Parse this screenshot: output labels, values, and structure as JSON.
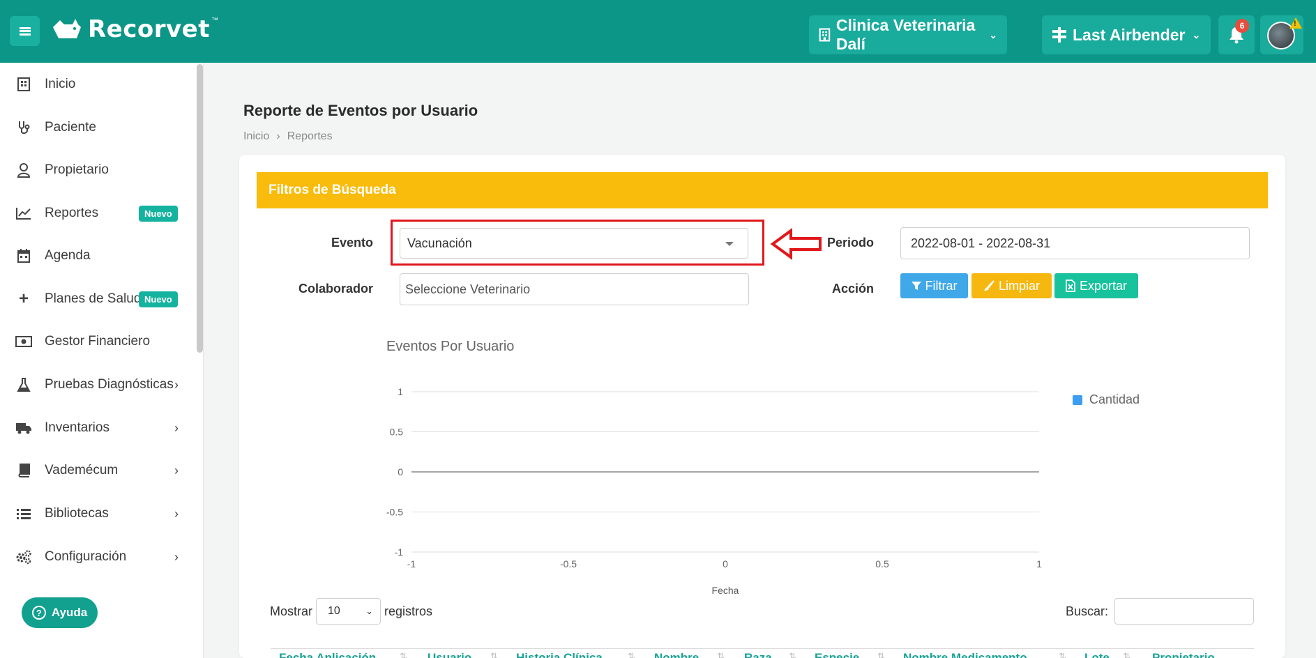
{
  "header": {
    "brand": "Recorvet",
    "brand_tm": "™",
    "clinic": "Clinica Veterinaria Dalí",
    "branch": "Last Airbender",
    "notifications_count": "6",
    "accent_color": "#0b9688"
  },
  "sidebar": {
    "items": [
      {
        "label": "Inicio",
        "icon": "hospital-icon"
      },
      {
        "label": "Paciente",
        "icon": "stethoscope-icon"
      },
      {
        "label": "Propietario",
        "icon": "user-icon"
      },
      {
        "label": "Reportes",
        "icon": "chart-line-icon",
        "badge": "Nuevo"
      },
      {
        "label": "Agenda",
        "icon": "calendar-icon"
      },
      {
        "label": "Planes de Salud",
        "icon": "plus-icon",
        "badge": "Nuevo"
      },
      {
        "label": "Gestor Financiero",
        "icon": "money-bill-icon"
      },
      {
        "label": "Pruebas Diagnósticas",
        "icon": "flask-icon"
      },
      {
        "label": "Inventarios",
        "icon": "truck-icon"
      },
      {
        "label": "Vademécum",
        "icon": "book-icon"
      },
      {
        "label": "Bibliotecas",
        "icon": "list-icon"
      },
      {
        "label": "Configuración",
        "icon": "gears-icon"
      }
    ],
    "help_label": "Ayuda"
  },
  "page": {
    "title": "Reporte de Eventos por Usuario",
    "breadcrumb": [
      "Inicio",
      "Reportes"
    ]
  },
  "filters": {
    "heading": "Filtros de Búsqueda",
    "evento_label": "Evento",
    "evento_value": "Vacunación",
    "periodo_label": "Periodo",
    "periodo_value": "2022-08-01 - 2022-08-31",
    "colaborador_label": "Colaborador",
    "colaborador_placeholder": "Seleccione Veterinario",
    "accion_label": "Acción",
    "btn_filtrar": "Filtrar",
    "btn_limpiar": "Limpiar",
    "btn_exportar": "Exportar",
    "colors": {
      "filtrar": "#3fa8e8",
      "limpiar": "#f6b70e",
      "exportar": "#18c29c",
      "header": "#f9bc0c"
    }
  },
  "chart_data": {
    "type": "line",
    "title": "Eventos Por Usuario",
    "xlabel": "Fecha",
    "ylabel": "",
    "xlim": [
      -1,
      1
    ],
    "ylim": [
      -1,
      1
    ],
    "x_ticks": [
      "-1",
      "-0.5",
      "0",
      "0.5",
      "1"
    ],
    "y_ticks": [
      "1",
      "0.5",
      "0",
      "-0.5",
      "-1"
    ],
    "series": [
      {
        "name": "Cantidad",
        "color": "#3d9df0",
        "values": []
      }
    ],
    "legend": "top-right",
    "grid": true
  },
  "table": {
    "show_label": "Mostrar",
    "page_size": "10",
    "records_label": "registros",
    "search_label": "Buscar:",
    "columns": [
      "Fecha Aplicación",
      "Usuario",
      "Historia Clínica",
      "Nombre",
      "Raza",
      "Especie",
      "Nombre Medicamento",
      "Lote",
      "Propietario"
    ]
  }
}
